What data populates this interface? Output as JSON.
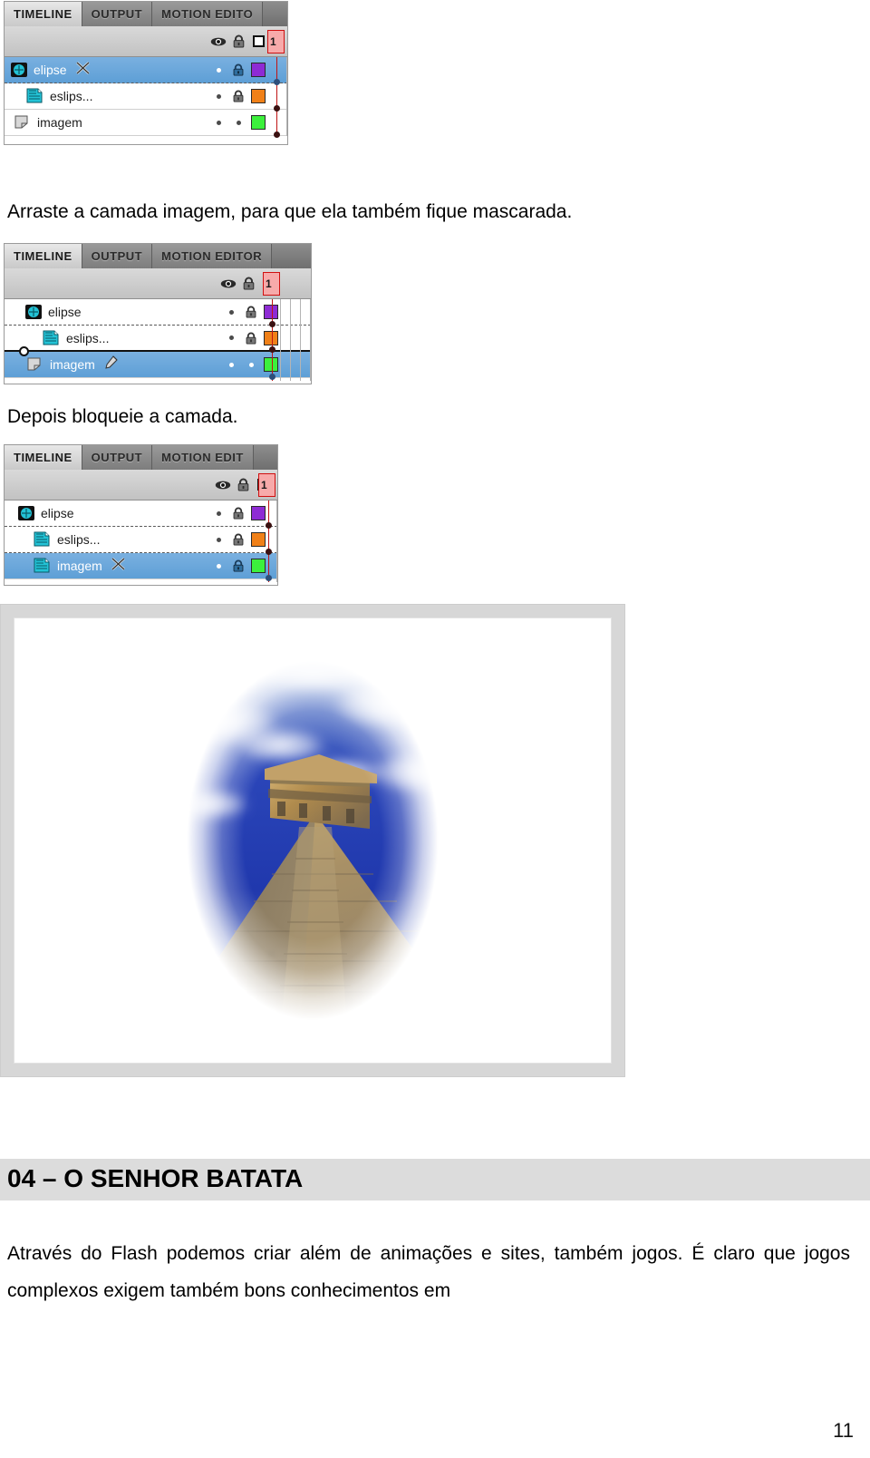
{
  "document": {
    "page_number": "11",
    "section_heading": "04 – O SENHOR BATATA",
    "paragraph": "Através do Flash podemos criar além de animações e sites, também jogos. É claro que jogos complexos exigem também bons conhecimentos em",
    "instruction_1": "Arraste a camada imagem, para que ela também fique mascarada.",
    "instruction_2": "Depois bloqueie a camada."
  },
  "timeline_tabs": {
    "timeline": "TIMELINE",
    "output": "OUTPUT",
    "motion_editor": "MOTION EDITOR",
    "motion_editor_clipped_1": "MOTION EDITO",
    "motion_editor_clipped_2": "MOTION EDIT"
  },
  "timeline_header": {
    "eye_icon": "eye-icon",
    "lock_icon": "lock-icon",
    "outline_icon": "outline-square-icon",
    "frame_number": "1"
  },
  "panels": [
    {
      "id": "panel-top",
      "label": "timeline-panel-top",
      "selected_layer": "elipse",
      "layers": [
        {
          "name": "elipse",
          "icon": "mask-layer-icon",
          "selected": true,
          "tool_icon": "crossed-tools-icon",
          "visible_dot": "white",
          "locked": true,
          "color": "#8e2bd4",
          "keyframe": true
        },
        {
          "name": "eslips...",
          "icon": "masked-layer-icon",
          "selected": false,
          "tool_icon": "none",
          "visible_dot": "dark",
          "locked": true,
          "color": "#f08018",
          "keyframe": true
        },
        {
          "name": "imagem",
          "icon": "guide-layer-icon",
          "selected": false,
          "tool_icon": "none",
          "visible_dot": "dark",
          "locked": false,
          "color": "#3cf03c",
          "keyframe": true
        }
      ]
    },
    {
      "id": "panel-middle",
      "label": "timeline-panel-middle",
      "selected_layer": "imagem",
      "layers": [
        {
          "name": "elipse",
          "icon": "mask-layer-icon",
          "selected": false,
          "tool_icon": "none",
          "visible_dot": "dark",
          "locked": true,
          "color": "#8e2bd4",
          "keyframe": true
        },
        {
          "name": "eslips...",
          "icon": "masked-layer-icon",
          "selected": false,
          "tool_icon": "none",
          "visible_dot": "dark",
          "locked": true,
          "color": "#f08018",
          "keyframe": true
        },
        {
          "name": "imagem",
          "icon": "guide-layer-icon",
          "selected": true,
          "tool_icon": "pencil-icon",
          "visible_dot": "white",
          "locked": false,
          "color": "#3cf03c",
          "keyframe": true
        }
      ]
    },
    {
      "id": "panel-bottom",
      "label": "timeline-panel-bottom",
      "selected_layer": "imagem",
      "layers": [
        {
          "name": "elipse",
          "icon": "mask-layer-icon",
          "selected": false,
          "tool_icon": "none",
          "visible_dot": "dark",
          "locked": true,
          "color": "#8e2bd4",
          "keyframe": true
        },
        {
          "name": "eslips...",
          "icon": "masked-layer-icon",
          "selected": false,
          "tool_icon": "none",
          "visible_dot": "dark",
          "locked": true,
          "color": "#f08018",
          "keyframe": true
        },
        {
          "name": "imagem",
          "icon": "masked-layer-icon",
          "selected": true,
          "tool_icon": "crossed-tools-icon",
          "visible_dot": "white",
          "locked": true,
          "color": "#3cf03c",
          "keyframe": true
        }
      ]
    }
  ],
  "stage": {
    "label": "flash-stage-preview",
    "content": "masked-pyramid-image",
    "description": "Mayan step pyramid under blue sky with clouds, soft oval mask"
  },
  "colors": {
    "selection_blue": "#5e9fd6",
    "playhead_red": "#d01010",
    "heading_background": "#dcdcdc",
    "panel_gray": "#c2c2c2",
    "stage_border": "#d7d7d7"
  }
}
